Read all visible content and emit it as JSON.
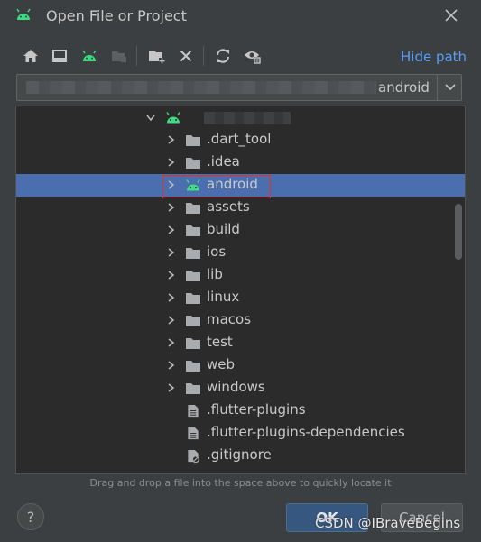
{
  "window": {
    "title": "Open File or Project",
    "icon": "android-icon",
    "close_icon": "close-icon"
  },
  "toolbar": {
    "buttons": [
      {
        "name": "home-icon",
        "tooltip": ""
      },
      {
        "name": "desktop-icon",
        "tooltip": ""
      },
      {
        "name": "android-project-icon",
        "tooltip": ""
      },
      {
        "name": "new-folder-disabled-icon",
        "tooltip": ""
      },
      {
        "name": "new-folder-icon",
        "tooltip": ""
      },
      {
        "name": "delete-icon",
        "tooltip": ""
      },
      {
        "name": "refresh-icon",
        "tooltip": ""
      },
      {
        "name": "show-hidden-icon",
        "tooltip": ""
      }
    ],
    "hide_path_label": "Hide path"
  },
  "path": {
    "visible_value": "android"
  },
  "tree": {
    "selected": "android",
    "items": [
      {
        "label": "",
        "type": "android-root",
        "expanded": true
      },
      {
        "label": ".dart_tool",
        "type": "folder"
      },
      {
        "label": ".idea",
        "type": "folder"
      },
      {
        "label": "android",
        "type": "android-module"
      },
      {
        "label": "assets",
        "type": "folder"
      },
      {
        "label": "build",
        "type": "folder"
      },
      {
        "label": "ios",
        "type": "folder"
      },
      {
        "label": "lib",
        "type": "folder"
      },
      {
        "label": "linux",
        "type": "folder"
      },
      {
        "label": "macos",
        "type": "folder"
      },
      {
        "label": "test",
        "type": "folder"
      },
      {
        "label": "web",
        "type": "folder"
      },
      {
        "label": "windows",
        "type": "folder"
      },
      {
        "label": ".flutter-plugins",
        "type": "file"
      },
      {
        "label": ".flutter-plugins-dependencies",
        "type": "file"
      },
      {
        "label": ".gitignore",
        "type": "ignored-file"
      }
    ]
  },
  "hint_text": "Drag and drop a file into the space above to quickly locate it",
  "buttons": {
    "help": "?",
    "ok": "OK",
    "cancel": "Cancel"
  },
  "watermark": "CSDN @IBraveBegins",
  "colors": {
    "background": "#3c3f41",
    "tree_background": "#2b2b2b",
    "selection": "#4b6eaf",
    "link": "#589df6",
    "android_green": "#3ddc84",
    "highlight_box": "#e0312b"
  }
}
